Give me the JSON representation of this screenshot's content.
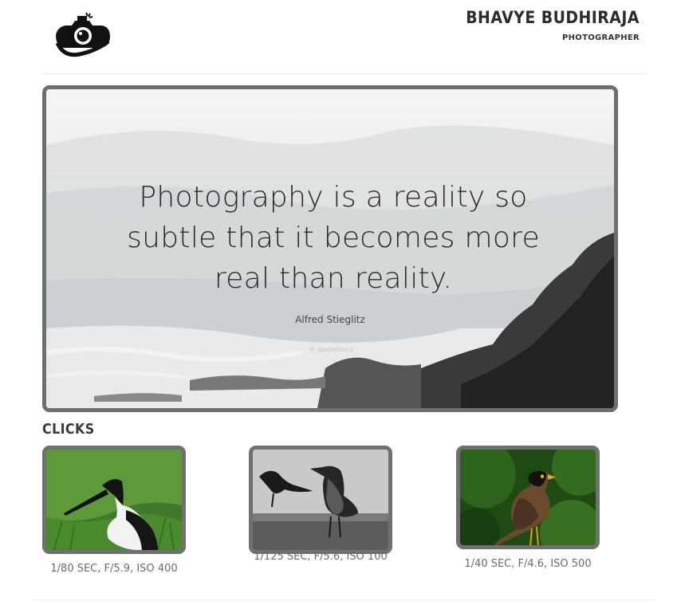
{
  "header": {
    "logo_icon": "camera-icon",
    "name": "BHAVYE BUDHIRAJA",
    "role": "PHOTOGRAPHER"
  },
  "hero": {
    "quote": "Photography is a reality so subtle that it becomes more real than reality.",
    "author": "Alfred Stieglitz",
    "watermark": "© quotefancy"
  },
  "clicks": {
    "title": "CLICKS",
    "items": [
      {
        "subject": "black-necked stork",
        "caption": "1/80 SEC, F/5.9, ISO 400"
      },
      {
        "subject": "crows",
        "caption": "1/125 SEC, F/5.6, ISO 100"
      },
      {
        "subject": "myna",
        "caption": "1/40 SEC, F/4.6, ISO 500"
      }
    ]
  },
  "colors": {
    "frame": "#707070",
    "text_dark": "#2c2c2c",
    "caption": "#6a6a6a"
  }
}
